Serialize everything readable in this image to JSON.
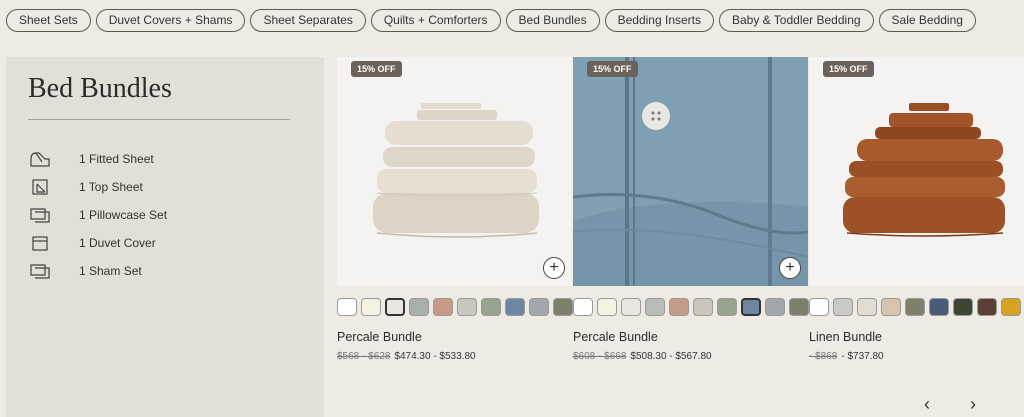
{
  "categories": [
    "Sheet Sets",
    "Duvet Covers + Shams",
    "Sheet Separates",
    "Quilts + Comforters",
    "Bed Bundles",
    "Bedding Inserts",
    "Baby & Toddler Bedding",
    "Sale Bedding"
  ],
  "sidebar": {
    "title": "Bed Bundles",
    "items": [
      {
        "icon": "fitted-sheet-icon",
        "label": "1 Fitted Sheet"
      },
      {
        "icon": "top-sheet-icon",
        "label": "1 Top Sheet"
      },
      {
        "icon": "pillowcase-icon",
        "label": "1 Pillowcase Set"
      },
      {
        "icon": "duvet-cover-icon",
        "label": "1 Duvet Cover"
      },
      {
        "icon": "sham-icon",
        "label": "1 Sham Set"
      }
    ]
  },
  "products": [
    {
      "badge": "15% OFF",
      "name": "Percale Bundle",
      "old_price": "$568 - $628",
      "price": "$474.30 - $533.80",
      "swatches": [
        "#ffffff",
        "#f5f1e3",
        "#e9e6df",
        "#a9b0aa",
        "#c69a88",
        "#cbc6bd",
        "#97a58f",
        "#6d86a3",
        "#a3a7ab",
        "#7c7f6b"
      ],
      "selected": 2
    },
    {
      "badge": "15% OFF",
      "name": "Percale Bundle",
      "old_price": "$608 - $668",
      "price": "$508.30 - $567.80",
      "swatches": [
        "#ffffff",
        "#f5f1e3",
        "#e9e6df",
        "#b8beb5",
        "#c69a88",
        "#cbc6bd",
        "#97a58f",
        "#6d86a3",
        "#a3a7ab",
        "#7c7f6b"
      ],
      "selected": 7
    },
    {
      "badge": "15% OFF",
      "name": "Linen Bundle",
      "old_price": "- $868",
      "price": "- $737.80",
      "swatches": [
        "#ffffff",
        "#c9cac6",
        "#e2ddd3",
        "#d6c3b0",
        "#7e7f6c",
        "#4a5b7a",
        "#3e4535",
        "#5a4034",
        "#d8a320",
        "#b8703f"
      ],
      "selected": -1
    }
  ],
  "nav": {
    "prev": "‹",
    "next": "›"
  }
}
